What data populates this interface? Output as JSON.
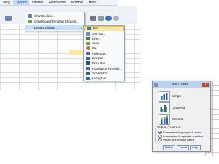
{
  "menubar": {
    "items": [
      {
        "label": "ating"
      },
      {
        "label": "Graphs",
        "active": true
      },
      {
        "label": "Utilities"
      },
      {
        "label": "Extensions"
      },
      {
        "label": "Window"
      },
      {
        "label": "Help"
      }
    ]
  },
  "graphs_menu": {
    "items": [
      {
        "label": "Chart Builder...",
        "icon": "chart-builder-icon"
      },
      {
        "label": "Graphboard Template Chooser...",
        "icon": "graphboard-icon"
      },
      {
        "label": "Legacy Dialogs",
        "icon": "",
        "has_submenu": true,
        "highlighted": true
      }
    ]
  },
  "legacy_menu": {
    "items": [
      {
        "label": "Bar...",
        "icon": "bar-icon",
        "highlighted": true
      },
      {
        "label": "3-D Bar...",
        "icon": "bar-3d-icon"
      },
      {
        "label": "Line...",
        "icon": "line-icon"
      },
      {
        "label": "Area...",
        "icon": "area-icon"
      },
      {
        "label": "Pie...",
        "icon": "pie-icon"
      },
      {
        "label": "High-Low...",
        "icon": "high-low-icon"
      },
      {
        "label": "Boxplot...",
        "icon": "boxplot-icon"
      },
      {
        "label": "Error Bar...",
        "icon": "error-bar-icon"
      },
      {
        "label": "Population Pyramid...",
        "icon": "pyramid-icon"
      },
      {
        "label": "Scatter/Dot...",
        "icon": "scatter-icon"
      },
      {
        "label": "Histogram...",
        "icon": "histogram-icon"
      }
    ]
  },
  "dialog": {
    "title": "Bar Charts",
    "close_label": "X",
    "options": [
      {
        "label": "Simple"
      },
      {
        "label": "Clustered"
      },
      {
        "label": "Stacked"
      }
    ],
    "data_group_label": "Data in Chart Are",
    "radios": [
      {
        "label": "Summaries for groups of cases",
        "checked": true
      },
      {
        "label": "Summaries of separate variables",
        "checked": false
      },
      {
        "label": "Values of individual cases",
        "checked": false
      }
    ],
    "buttons": {
      "define": "Define",
      "cancel": "Cancel",
      "help": "Help"
    }
  },
  "colors": {
    "accent": "#2b5ca8",
    "highlight": "#fbe8a5",
    "menu_highlight": "#c9e0fb",
    "close": "#c7433b"
  }
}
